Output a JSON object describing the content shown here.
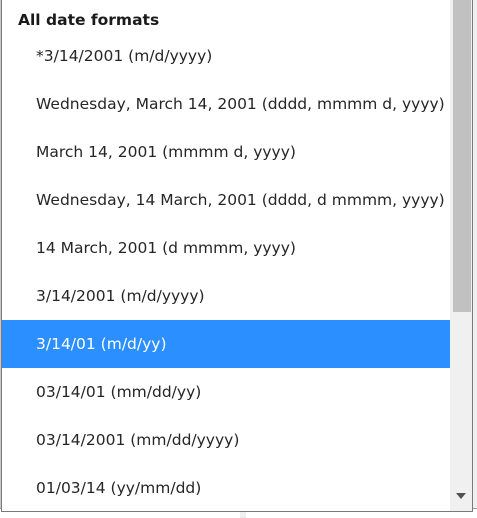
{
  "dropdown": {
    "group_header": "All date formats",
    "options": [
      {
        "label": "*3/14/2001 (m/d/yyyy)"
      },
      {
        "label": "Wednesday, March 14, 2001 (dddd, mmmm d, yyyy)"
      },
      {
        "label": "March 14, 2001 (mmmm d, yyyy)"
      },
      {
        "label": "Wednesday, 14 March, 2001 (dddd, d mmmm, yyyy)"
      },
      {
        "label": "14 March, 2001 (d mmmm, yyyy)"
      },
      {
        "label": "3/14/2001 (m/d/yyyy)"
      },
      {
        "label": "3/14/01 (m/d/yy)"
      },
      {
        "label": "03/14/01 (mm/dd/yy)"
      },
      {
        "label": "03/14/2001 (mm/dd/yyyy)"
      },
      {
        "label": "01/03/14 (yy/mm/dd)"
      }
    ],
    "selected_label": "3/14/01 (m/d/yy)"
  },
  "colors": {
    "selection": "#2b8fff",
    "text": "#262626",
    "scrollbar_thumb": "#c1c1c1"
  },
  "icons": {
    "scroll_down": "scroll-down-arrow-icon"
  }
}
